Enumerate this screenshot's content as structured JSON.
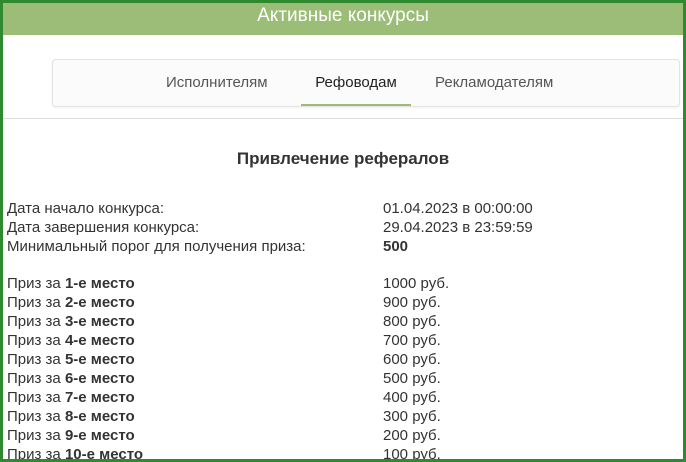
{
  "header": {
    "title": "Активные конкурсы"
  },
  "tabs": [
    {
      "label": "Исполнителям",
      "active": false
    },
    {
      "label": "Рефоводам",
      "active": true
    },
    {
      "label": "Рекламодателям",
      "active": false
    }
  ],
  "contest": {
    "title": "Привлечение рефералов",
    "start_label": "Дата начало конкурса:",
    "start_value": "01.04.2023 в 00:00:00",
    "end_label": "Дата завершения конкурса:",
    "end_value": "29.04.2023 в 23:59:59",
    "threshold_label": "Минимальный порог для получения приза:",
    "threshold_value": "500"
  },
  "prizes": {
    "prefix": "Приз за",
    "items": [
      {
        "place": "1-е место",
        "amount": "1000 руб."
      },
      {
        "place": "2-е место",
        "amount": "900 руб."
      },
      {
        "place": "3-е место",
        "amount": "800 руб."
      },
      {
        "place": "4-е место",
        "amount": "700 руб."
      },
      {
        "place": "5-е место",
        "amount": "600 руб."
      },
      {
        "place": "6-е место",
        "amount": "500 руб."
      },
      {
        "place": "7-е место",
        "amount": "400 руб."
      },
      {
        "place": "8-е место",
        "amount": "300 руб."
      },
      {
        "place": "9-е место",
        "amount": "200 руб."
      },
      {
        "place": "10-е место",
        "amount": "100 руб."
      }
    ]
  },
  "colors": {
    "header_bg": "#9cbd77",
    "frame_border": "#2f8a2f",
    "tab_underline": "#9cbd77"
  }
}
